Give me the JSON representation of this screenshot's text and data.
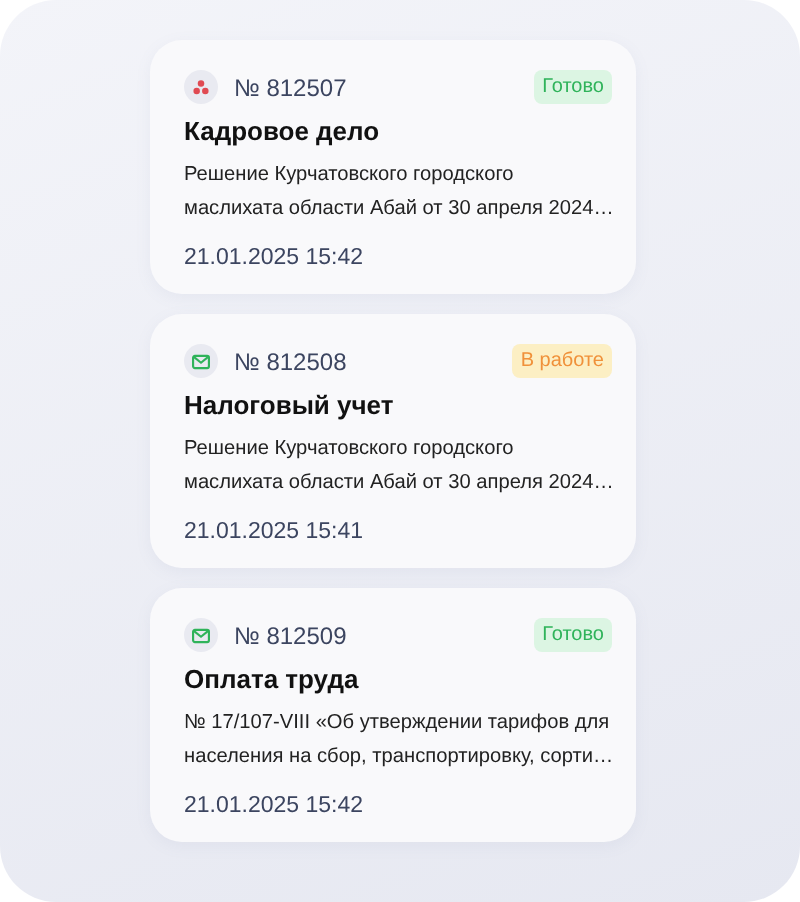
{
  "cards": [
    {
      "icon": {
        "kind": "people"
      },
      "number": "№ 812507",
      "status": {
        "kind": "done",
        "label": "Готово"
      },
      "title": "Кадровое дело",
      "description": [
        "Решение Курчатовского городского",
        "маслихата области Абай от 30 апреля 2024…"
      ],
      "date": "21.01.2025 15:42"
    },
    {
      "icon": {
        "kind": "mail"
      },
      "number": "№ 812508",
      "status": {
        "kind": "in_progress",
        "label": "В работе"
      },
      "title": "Налоговый учет",
      "description": [
        "Решение Курчатовского городского",
        "маслихата области Абай от 30 апреля 2024…"
      ],
      "date": "21.01.2025 15:41"
    },
    {
      "icon": {
        "kind": "mail"
      },
      "number": "№ 812509",
      "status": {
        "kind": "done",
        "label": "Готово"
      },
      "title": "Оплата труда",
      "description": [
        "№ 17/107-VIII «Об утверждении тарифов для",
        "населения на сбор, транспортировку, сорти…"
      ],
      "date": "21.01.2025 15:42"
    }
  ]
}
